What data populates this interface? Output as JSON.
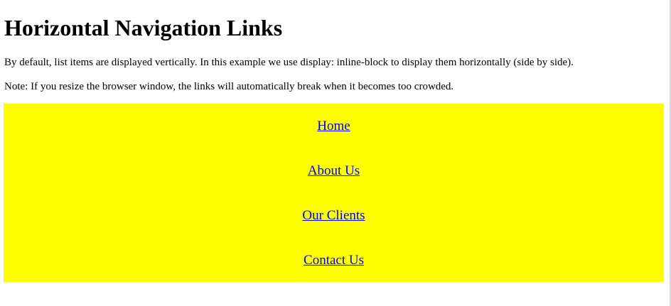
{
  "page": {
    "title": "Horizontal Navigation Links",
    "intro_1": "By default, list items are displayed vertically. In this example we use display: inline-block to display them horizontally (side by side).",
    "intro_2": "Note: If you resize the browser window, the links will automatically break when it becomes too crowded."
  },
  "nav": {
    "items": [
      {
        "label": "Home"
      },
      {
        "label": "About Us"
      },
      {
        "label": "Our Clients"
      },
      {
        "label": "Contact Us"
      }
    ]
  },
  "colors": {
    "nav_background": "#ffff00",
    "link": "#0000ee",
    "text": "#000000",
    "page_background": "#ffffff"
  }
}
